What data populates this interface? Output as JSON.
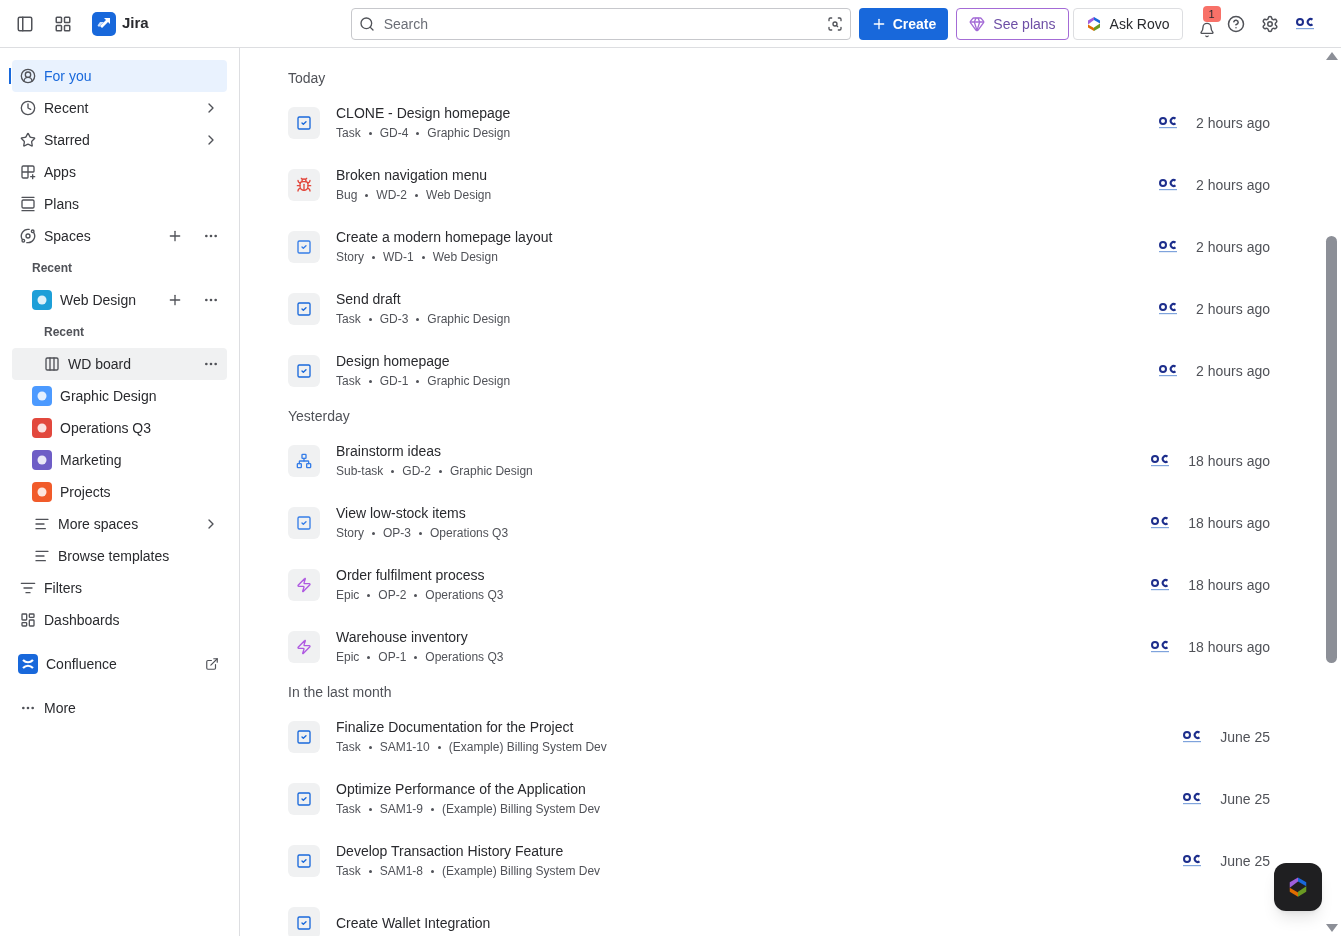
{
  "header": {
    "product": "Jira",
    "search": {
      "placeholder": "Search"
    },
    "create": "Create",
    "see_plans": "See plans",
    "ask_rovo": "Ask Rovo",
    "notifications": "1"
  },
  "sidebar": {
    "items": [
      {
        "label": "For you",
        "selected": true
      },
      {
        "label": "Recent",
        "selected": false
      },
      {
        "label": "Starred",
        "selected": false
      },
      {
        "label": "Apps",
        "selected": false
      },
      {
        "label": "Plans",
        "selected": false
      },
      {
        "label": "Spaces",
        "selected": false,
        "children": [
          {
            "kind": "heading",
            "label": "Recent"
          },
          {
            "kind": "space",
            "label": "Web Design",
            "color": "#1d9fd8",
            "selected": false,
            "children": [
              {
                "kind": "heading",
                "label": "Recent"
              },
              {
                "kind": "board",
                "label": "WD board",
                "selected": false,
                "hovered": true
              }
            ]
          },
          {
            "kind": "space",
            "label": "Graphic Design",
            "color": "#4c9aff",
            "selected": false
          },
          {
            "kind": "space",
            "label": "Operations Q3",
            "color": "#e2483d",
            "selected": false
          },
          {
            "kind": "space",
            "label": "Marketing",
            "color": "#6e5dc6",
            "selected": false
          },
          {
            "kind": "space",
            "label": "Projects",
            "color": "#f15b2a",
            "selected": false
          },
          {
            "kind": "link",
            "label": "More spaces",
            "selected": false
          },
          {
            "kind": "link",
            "label": "Browse templates",
            "selected": false
          }
        ]
      },
      {
        "label": "Filters",
        "selected": false
      },
      {
        "label": "Dashboards",
        "selected": false
      },
      {
        "label": "Confluence",
        "selected": false
      },
      {
        "label": "More",
        "selected": false
      }
    ]
  },
  "sections": [
    {
      "heading": "Today",
      "rows": [
        {
          "kind": "task",
          "title": "CLONE - Design homepage",
          "type": "Task",
          "key": "GD-4",
          "project": "Graphic Design",
          "time": "2 hours ago"
        },
        {
          "kind": "bug",
          "title": "Broken navigation menu",
          "type": "Bug",
          "key": "WD-2",
          "project": "Web Design",
          "time": "2 hours ago"
        },
        {
          "kind": "story",
          "title": "Create a modern homepage layout",
          "type": "Story",
          "key": "WD-1",
          "project": "Web Design",
          "time": "2 hours ago"
        },
        {
          "kind": "task",
          "title": "Send draft",
          "type": "Task",
          "key": "GD-3",
          "project": "Graphic Design",
          "time": "2 hours ago"
        },
        {
          "kind": "task",
          "title": "Design homepage",
          "type": "Task",
          "key": "GD-1",
          "project": "Graphic Design",
          "time": "2 hours ago"
        }
      ]
    },
    {
      "heading": "Yesterday",
      "rows": [
        {
          "kind": "subtask",
          "title": "Brainstorm ideas",
          "type": "Sub-task",
          "key": "GD-2",
          "project": "Graphic Design",
          "time": "18 hours ago"
        },
        {
          "kind": "story",
          "title": "View low-stock items",
          "type": "Story",
          "key": "OP-3",
          "project": "Operations Q3",
          "time": "18 hours ago"
        },
        {
          "kind": "epic",
          "title": "Order fulfilment process",
          "type": "Epic",
          "key": "OP-2",
          "project": "Operations Q3",
          "time": "18 hours ago"
        },
        {
          "kind": "epic",
          "title": "Warehouse inventory",
          "type": "Epic",
          "key": "OP-1",
          "project": "Operations Q3",
          "time": "18 hours ago"
        }
      ]
    },
    {
      "heading": "In the last month",
      "rows": [
        {
          "kind": "task",
          "title": "Finalize Documentation for the Project",
          "type": "Task",
          "key": "SAM1-10",
          "project": "(Example) Billing System Dev",
          "time": "June 25"
        },
        {
          "kind": "task",
          "title": "Optimize Performance of the Application",
          "type": "Task",
          "key": "SAM1-9",
          "project": "(Example) Billing System Dev",
          "time": "June 25"
        },
        {
          "kind": "task",
          "title": "Develop Transaction History Feature",
          "type": "Task",
          "key": "SAM1-8",
          "project": "(Example) Billing System Dev",
          "time": "June 25"
        },
        {
          "kind": "task",
          "title": "Create Wallet Integration"
        }
      ]
    }
  ]
}
